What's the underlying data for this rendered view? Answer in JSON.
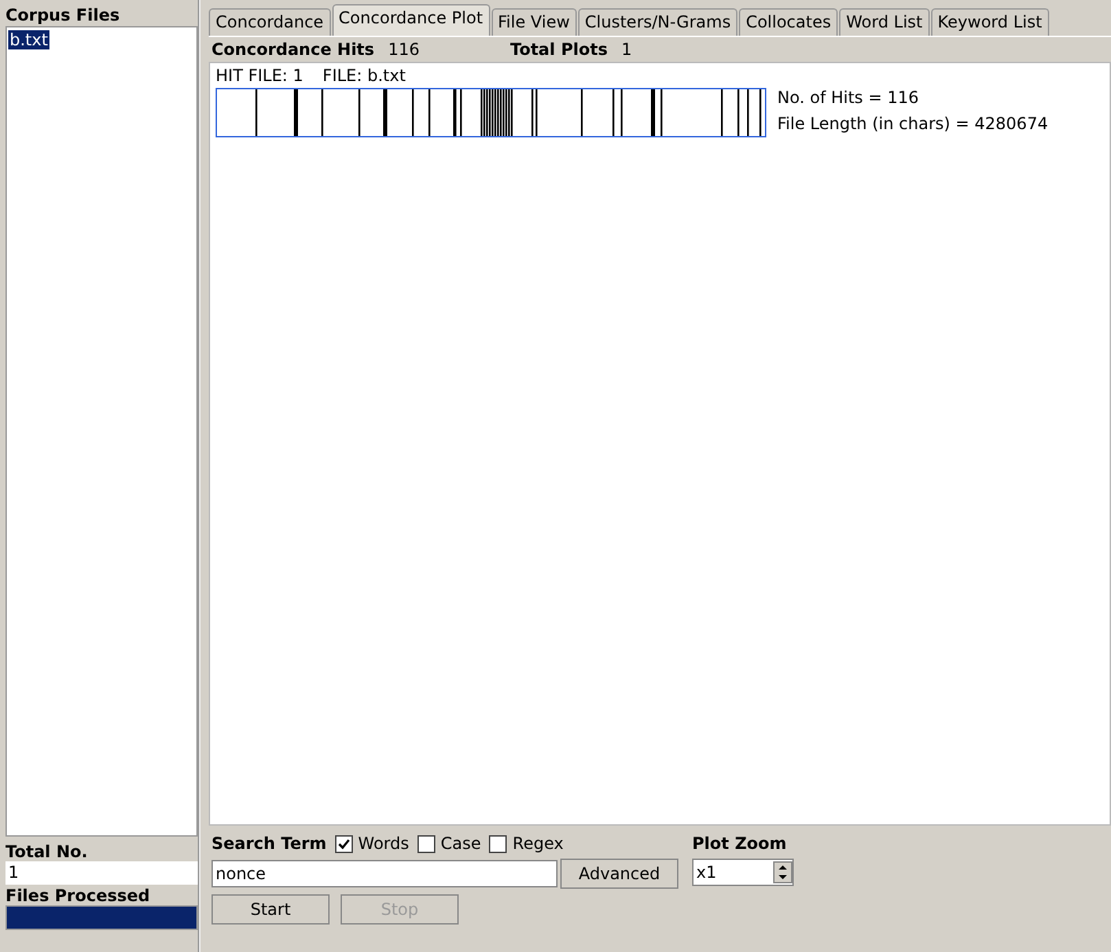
{
  "corpus_files": {
    "title": "Corpus Files",
    "items": [
      {
        "label": "b.txt",
        "selected": true
      }
    ]
  },
  "totals": {
    "total_label": "Total No.",
    "total_value": "1",
    "processed_label": "Files Processed",
    "progress": {
      "level": 1
    }
  },
  "tabs": [
    {
      "label": "Concordance",
      "selected": false
    },
    {
      "label": "Concordance Plot",
      "selected": true
    },
    {
      "label": "File View",
      "selected": false
    },
    {
      "label": "Clusters/N-Grams",
      "selected": false
    },
    {
      "label": "Collocates",
      "selected": false
    },
    {
      "label": "Word List",
      "selected": false
    },
    {
      "label": "Keyword List",
      "selected": false
    }
  ],
  "header": {
    "hits_label": "Concordance Hits",
    "hits_value": "116",
    "plots_label": "Total Plots",
    "plots_value": "1"
  },
  "plot": {
    "hit_file": "HIT FILE: 1",
    "file": "FILE: b.txt",
    "hits_info": "No. of Hits = 116",
    "length_info": "File Length (in chars) = 4280674"
  },
  "search": {
    "label": "Search Term",
    "options": [
      {
        "label": "Words",
        "checked": true
      },
      {
        "label": "Case",
        "checked": false
      },
      {
        "label": "Regex",
        "checked": false
      }
    ],
    "value": "nonce",
    "advanced": "Advanced",
    "start": "Start",
    "stop": {
      "label": "Stop",
      "disabled": true
    }
  },
  "zoom": {
    "label": "Plot Zoom",
    "value": "x1"
  }
}
